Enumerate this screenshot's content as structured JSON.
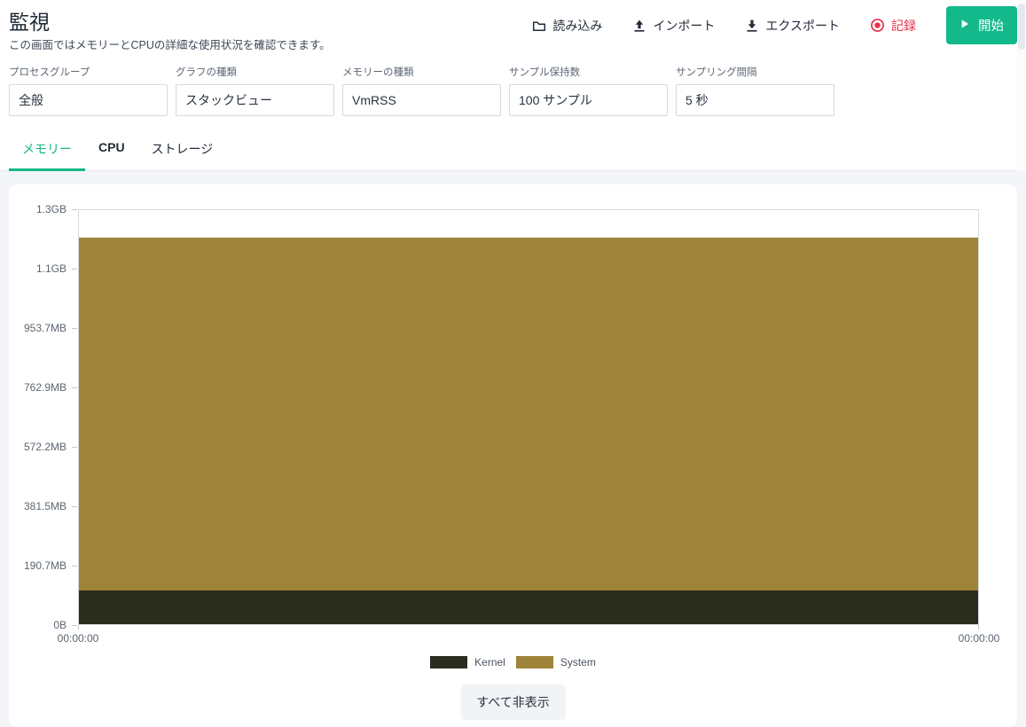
{
  "page": {
    "title": "監視",
    "subtitle": "この画面ではメモリーとCPUの詳細な使用状況を確認できます。"
  },
  "toolbar": {
    "load_label": "読み込み",
    "import_label": "インポート",
    "export_label": "エクスポート",
    "record_label": "記録",
    "start_label": "開始",
    "record_color": "#e8304a",
    "start_bg_color": "#13b98a"
  },
  "filters": [
    {
      "label": "プロセスグループ",
      "value": "全般"
    },
    {
      "label": "グラフの種類",
      "value": "スタックビュー"
    },
    {
      "label": "メモリーの種類",
      "value": "VmRSS"
    },
    {
      "label": "サンプル保持数",
      "value": "100 サンプル"
    },
    {
      "label": "サンプリング間隔",
      "value": "5 秒"
    }
  ],
  "tabs": [
    {
      "label": "メモリー",
      "active": true
    },
    {
      "label": "CPU",
      "active": false
    },
    {
      "label": "ストレージ",
      "active": false
    }
  ],
  "accent_color": "#12b688",
  "chart_data": {
    "type": "area",
    "stacked": true,
    "legend_position": "bottom",
    "x_start_label": "00:00:00",
    "x_end_label": "00:00:00",
    "ytick_labels": [
      "1.3GB",
      "1.1GB",
      "953.7MB",
      "762.9MB",
      "572.2MB",
      "381.5MB",
      "190.7MB",
      "0B"
    ],
    "ylim_bytes": [
      0,
      1400000000
    ],
    "series": [
      {
        "name": "Kernel",
        "color": "#2a2c1e",
        "value_bytes": 113000000
      },
      {
        "name": "System",
        "color": "#9e8338",
        "value_bytes": 1193000000
      }
    ]
  },
  "hide_all_label": "すべて非表示"
}
